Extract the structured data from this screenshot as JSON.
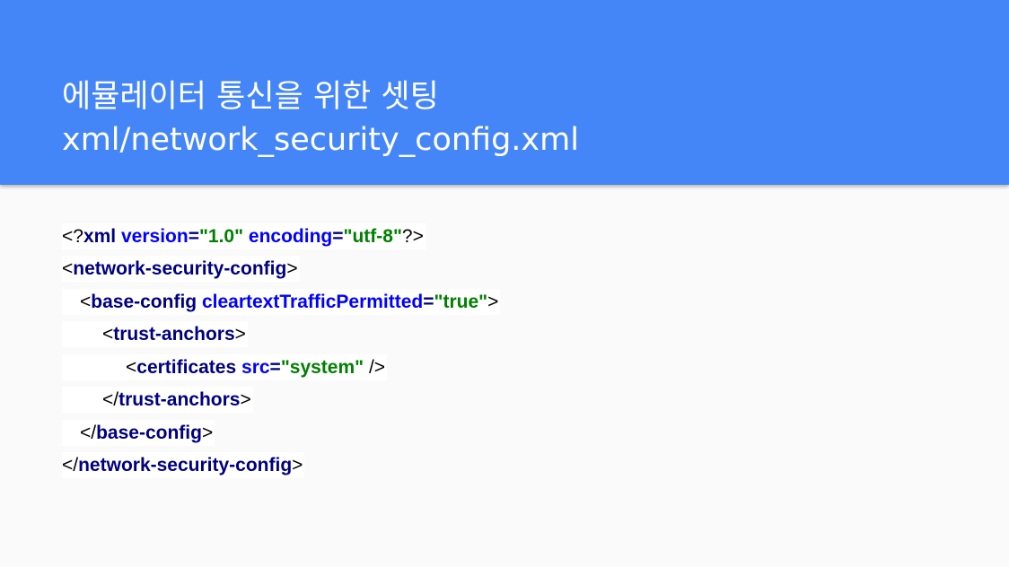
{
  "slide": {
    "title_line1": "에뮬레이터 통신을 위한 셋팅",
    "title_line2": "xml/network_security_config.xml"
  },
  "code_lines": [
    {
      "indent": 0,
      "tokens": [
        {
          "t": "<?",
          "k": "punct"
        },
        {
          "t": "xml",
          "k": "tag"
        },
        {
          "t": " ",
          "k": "punct"
        },
        {
          "t": "version",
          "k": "attr"
        },
        {
          "t": "=",
          "k": "eq"
        },
        {
          "t": "\"1.0\"",
          "k": "val"
        },
        {
          "t": " ",
          "k": "punct"
        },
        {
          "t": "encoding",
          "k": "attr"
        },
        {
          "t": "=",
          "k": "eq"
        },
        {
          "t": "\"utf-8\"",
          "k": "val"
        },
        {
          "t": "?>",
          "k": "punct"
        }
      ]
    },
    {
      "indent": 0,
      "tokens": [
        {
          "t": "<",
          "k": "punct"
        },
        {
          "t": "network-security-config",
          "k": "tag"
        },
        {
          "t": ">",
          "k": "punct"
        }
      ]
    },
    {
      "indent": 1,
      "tokens": [
        {
          "t": "<",
          "k": "punct"
        },
        {
          "t": "base-config",
          "k": "tag"
        },
        {
          "t": " ",
          "k": "punct"
        },
        {
          "t": "cleartextTrafficPermitted",
          "k": "attr"
        },
        {
          "t": "=",
          "k": "eq"
        },
        {
          "t": "\"true\"",
          "k": "val"
        },
        {
          "t": ">",
          "k": "punct"
        }
      ]
    },
    {
      "indent": 2,
      "tokens": [
        {
          "t": "<",
          "k": "punct"
        },
        {
          "t": "trust-anchors",
          "k": "tag"
        },
        {
          "t": ">",
          "k": "punct"
        }
      ]
    },
    {
      "indent": 3,
      "tokens": [
        {
          "t": "<",
          "k": "punct"
        },
        {
          "t": "certificates",
          "k": "tag"
        },
        {
          "t": " ",
          "k": "punct"
        },
        {
          "t": "src",
          "k": "attr"
        },
        {
          "t": "=",
          "k": "eq"
        },
        {
          "t": "\"system\"",
          "k": "val"
        },
        {
          "t": " />",
          "k": "punct"
        }
      ]
    },
    {
      "indent": 2,
      "tokens": [
        {
          "t": "</",
          "k": "punct"
        },
        {
          "t": "trust-anchors",
          "k": "tag"
        },
        {
          "t": ">",
          "k": "punct"
        }
      ]
    },
    {
      "indent": 1,
      "tokens": [
        {
          "t": "</",
          "k": "punct"
        },
        {
          "t": "base-config",
          "k": "tag"
        },
        {
          "t": ">",
          "k": "punct"
        }
      ]
    },
    {
      "indent": 0,
      "tokens": [
        {
          "t": "</",
          "k": "punct"
        },
        {
          "t": "network-security-config",
          "k": "tag"
        },
        {
          "t": ">",
          "k": "punct"
        }
      ]
    }
  ],
  "colors": {
    "header_bg": "#4486f7",
    "page_bg": "#fafafa",
    "tag": "#000080",
    "attribute": "#0000ff",
    "value": "#008000"
  }
}
